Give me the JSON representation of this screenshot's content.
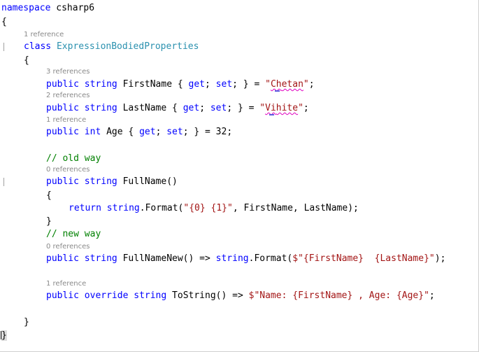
{
  "code": {
    "l1": {
      "kw": "namespace",
      "rest": " csharp6"
    },
    "l2": {
      "brace": "{"
    },
    "lens1": "1 reference",
    "l3": {
      "kw": "class",
      "type": "ExpressionBodiedProperties"
    },
    "l4": {
      "brace": "{"
    },
    "lens2": "3 references",
    "l5": {
      "kw1": "public",
      "kw2": "string",
      "name": "FirstName",
      "kw3": "get",
      "kw4": "set",
      "str_q1": "\"",
      "str_sq": "Ch",
      "str_rest": "etan",
      "str_q2": "\"",
      "semi": ";"
    },
    "lens3": "2 references",
    "l6": {
      "kw1": "public",
      "kw2": "string",
      "name": "LastName",
      "kw3": "get",
      "kw4": "set",
      "str_q1": "\"",
      "str_sq": "Vi",
      "str_rest": "hite",
      "str_q2": "\"",
      "semi": ";"
    },
    "lens4": "1 reference",
    "l7": {
      "kw1": "public",
      "kw2": "int",
      "name": "Age",
      "kw3": "get",
      "kw4": "set",
      "value": "32"
    },
    "l8": {
      "comment": "// old way"
    },
    "lens5": "0 references",
    "l9": {
      "kw1": "public",
      "kw2": "string",
      "name": "FullName()"
    },
    "l10": {
      "brace": "{"
    },
    "l11": {
      "kw1": "return",
      "kw2": "string",
      "call": ".Format(",
      "str": "\"{0} {1}\"",
      "args": ", FirstName, LastName);"
    },
    "l12": {
      "brace": "}"
    },
    "l13": {
      "comment": "// new way"
    },
    "lens6": "0 references",
    "l14": {
      "kw1": "public",
      "kw2": "string",
      "name": "FullNameNew() => ",
      "kw3": "string",
      "call": ".Format(",
      "str": "$\"{FirstName}  {LastName}\"",
      "end": ");"
    },
    "lens7": "1 reference",
    "l15": {
      "kw1": "public",
      "kw2": "override",
      "kw3": "string",
      "name": "ToString() => ",
      "str": "$\"Name: {FirstName} , Age: {Age}\"",
      "end": ";"
    },
    "l16": {
      "brace": "}"
    },
    "l17": {
      "brace": "}"
    }
  },
  "colors": {
    "keyword": "#0000ff",
    "type": "#2b91af",
    "string": "#a31515",
    "comment": "#008000",
    "codelens": "#8a8a8a"
  }
}
